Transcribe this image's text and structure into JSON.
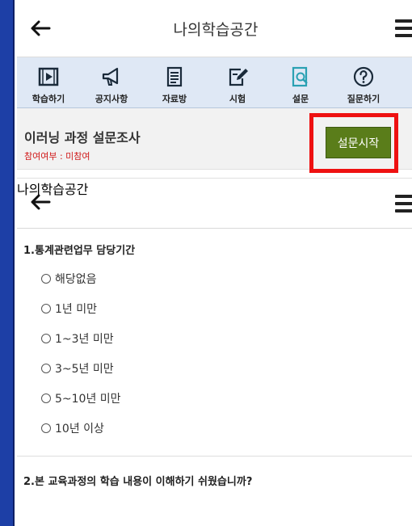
{
  "header": {
    "title": "나의학습공간"
  },
  "iconbar": {
    "items": [
      {
        "label": "학습하기",
        "icon": "play-icon"
      },
      {
        "label": "공지사항",
        "icon": "megaphone-icon"
      },
      {
        "label": "자료방",
        "icon": "document-icon"
      },
      {
        "label": "시험",
        "icon": "edit-icon"
      },
      {
        "label": "설문",
        "icon": "survey-search-icon"
      },
      {
        "label": "질문하기",
        "icon": "question-icon"
      }
    ]
  },
  "survey": {
    "title": "이러닝 과정 설문조사",
    "status": "참여여부 : 미참여",
    "start_label": "설문시작"
  },
  "header2": {
    "title": "나의학습공간"
  },
  "questions": [
    {
      "text": "1.통계관련업무 담당기간",
      "options": [
        "해당없음",
        "1년 미만",
        "1~3년 미만",
        "3~5년 미만",
        "5~10년 미만",
        "10년 이상"
      ]
    },
    {
      "text": "2.본 교육과정의 학습 내용이 이해하기 쉬웠습니까?",
      "options": []
    }
  ],
  "colors": {
    "accent": "#5a7d1a",
    "highlight": "#ee1111",
    "iconbar_bg": "#dfe8f5",
    "frame_bg": "#1d3fa6"
  }
}
